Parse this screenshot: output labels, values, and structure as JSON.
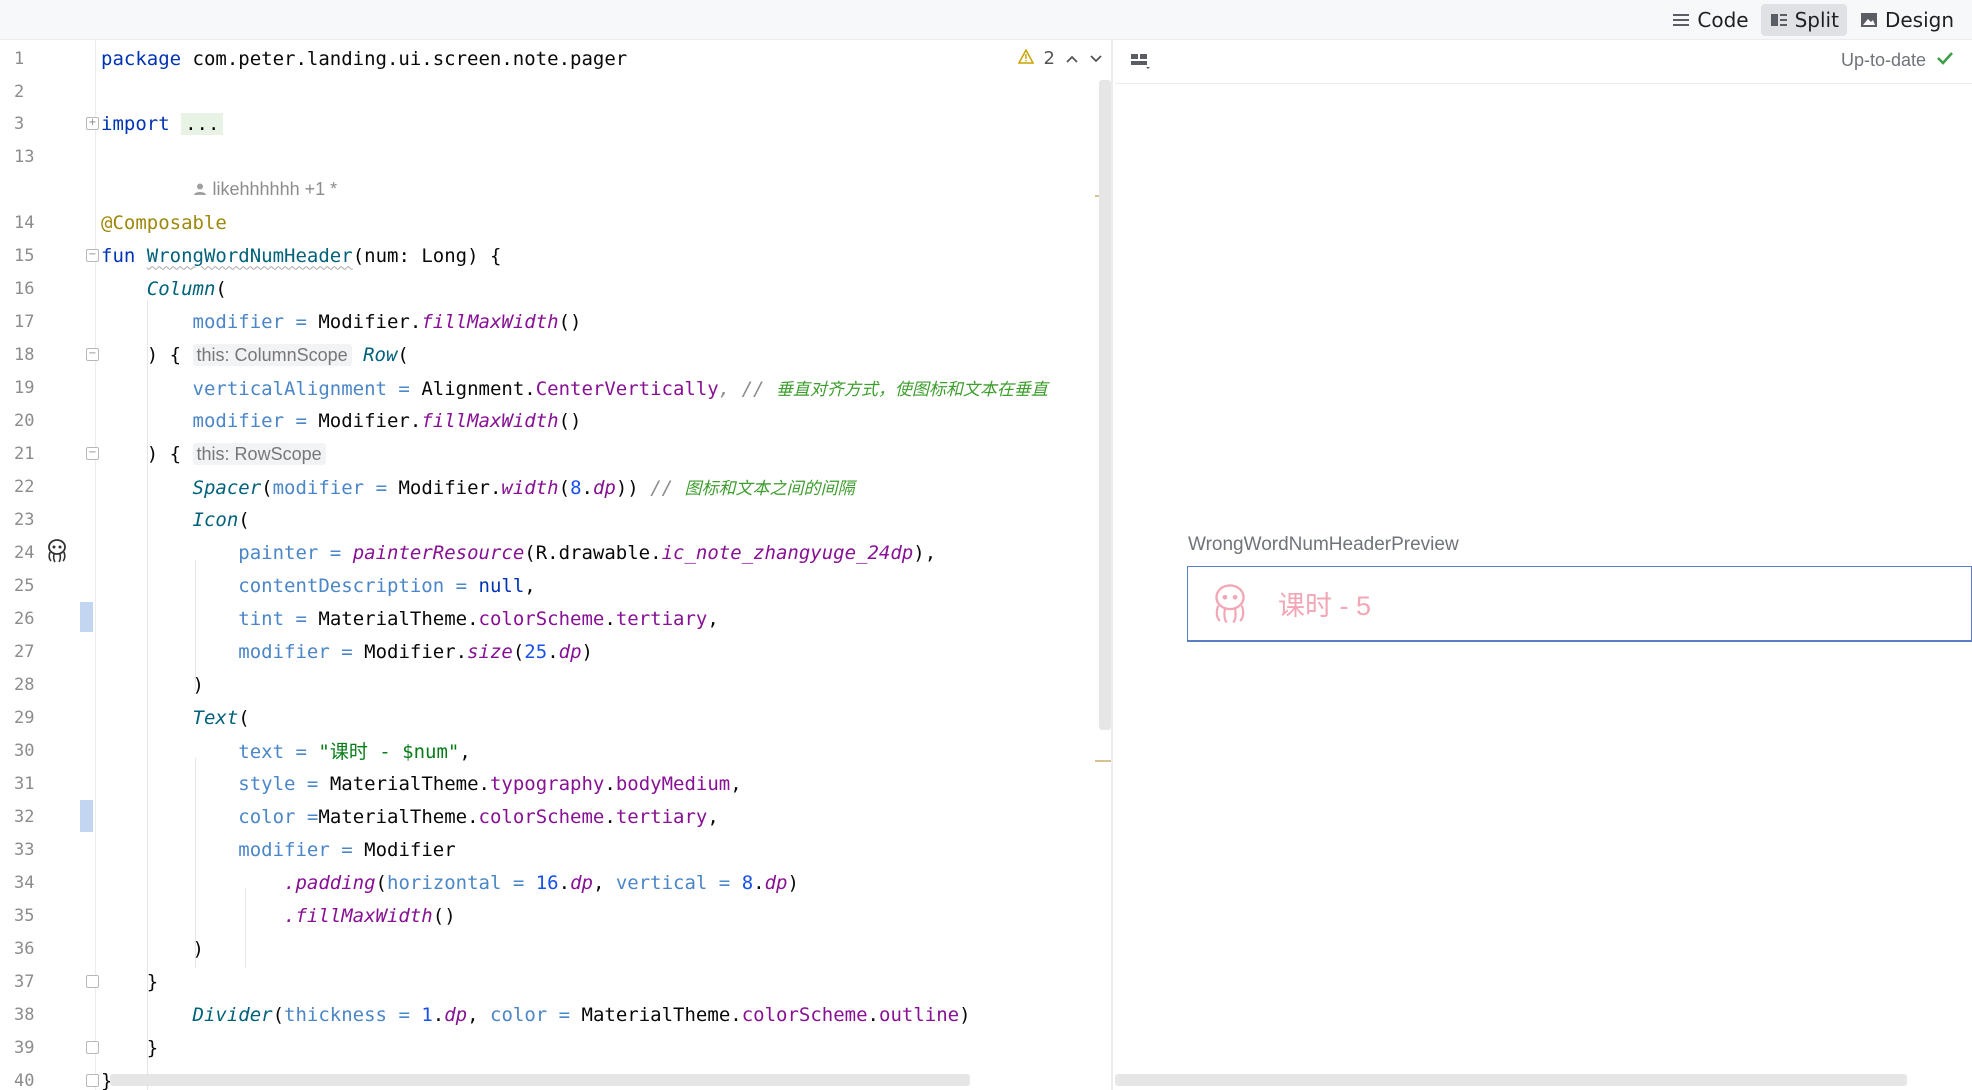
{
  "toolbar": {
    "modes": [
      {
        "label": "Code",
        "icon": "lines-icon",
        "active": false
      },
      {
        "label": "Split",
        "icon": "split-icon",
        "active": true
      },
      {
        "label": "Design",
        "icon": "image-icon",
        "active": false
      }
    ]
  },
  "editor": {
    "warnings_count": "2",
    "author_hint": "likehhhhhh +1 *",
    "lines": [
      {
        "n": "1"
      },
      {
        "n": "2"
      },
      {
        "n": "3"
      },
      {
        "n": "13"
      },
      {
        "n": "14"
      },
      {
        "n": "15"
      },
      {
        "n": "16"
      },
      {
        "n": "17"
      },
      {
        "n": "18"
      },
      {
        "n": "19"
      },
      {
        "n": "20"
      },
      {
        "n": "21"
      },
      {
        "n": "22"
      },
      {
        "n": "23"
      },
      {
        "n": "24"
      },
      {
        "n": "25"
      },
      {
        "n": "26"
      },
      {
        "n": "27"
      },
      {
        "n": "28"
      },
      {
        "n": "29"
      },
      {
        "n": "30"
      },
      {
        "n": "31"
      },
      {
        "n": "32"
      },
      {
        "n": "33"
      },
      {
        "n": "34"
      },
      {
        "n": "35"
      },
      {
        "n": "36"
      },
      {
        "n": "37"
      },
      {
        "n": "38"
      },
      {
        "n": "39"
      },
      {
        "n": "40"
      }
    ],
    "code": {
      "package_kw": "package",
      "package_name": " com.peter.landing.ui.screen.note.pager",
      "import_kw": "import",
      "import_dots": "...",
      "annotation": "@Composable",
      "fun_kw": "fun",
      "fun_name": "WrongWordNumHeader",
      "fun_params": "(num: Long) {",
      "column": "Column",
      "paren_open": "(",
      "modifier_kw": "modifier",
      "eq": " = ",
      "modifier_obj": "Modifier.",
      "fill_max_width": "fillMaxWidth",
      "empty_call": "()",
      "close_brace_open": ") {",
      "column_scope_hint": "this: ColumnScope",
      "row": "Row",
      "vertical_alignment": "verticalAlignment",
      "alignment_obj": "Alignment.",
      "center_vertically": "CenterVertically",
      "comma_comment": ", // ",
      "comment_vertical": "垂直对齐方式，使图标和文本在垂直",
      "row_scope_hint": "this: RowScope",
      "spacer": "Spacer",
      "width_fn": "width",
      "num_8": "8",
      "dp": "dp",
      "comment_spacer": "图标和文本之间的间隔",
      "icon": "Icon",
      "painter": "painter",
      "painter_resource": "painterResource",
      "r_drawable": "R.drawable.",
      "icon_res": "ic_note_zhangyuge_24dp",
      "content_description": "contentDescription",
      "null_kw": "null",
      "tint": "tint",
      "material_theme": "MaterialTheme.",
      "color_scheme": "colorScheme",
      "tertiary": "tertiary",
      "size_fn": "size",
      "num_25": "25",
      "close_paren": ")",
      "text_comp": "Text",
      "text_param": "text",
      "text_value": "\"课时 - $num\"",
      "style_param": "style",
      "typography": "typography",
      "body_medium": "bodyMedium",
      "color_param": "color",
      "modifier_plain": "Modifier",
      "padding_fn": ".padding",
      "horizontal": "horizontal",
      "num_16": "16",
      "vertical": "vertical",
      "fill_max_width_chain": ".fillMaxWidth",
      "close_brace": "}",
      "divider": "Divider",
      "thickness": "thickness",
      "num_1": "1",
      "outline": "outline"
    }
  },
  "preview": {
    "status": "Up-to-date",
    "component_name": "WrongWordNumHeaderPreview",
    "card_text": "课时 - 5",
    "accent_color": "#5b7ec4",
    "tertiary_color": "#f2a7b6"
  }
}
